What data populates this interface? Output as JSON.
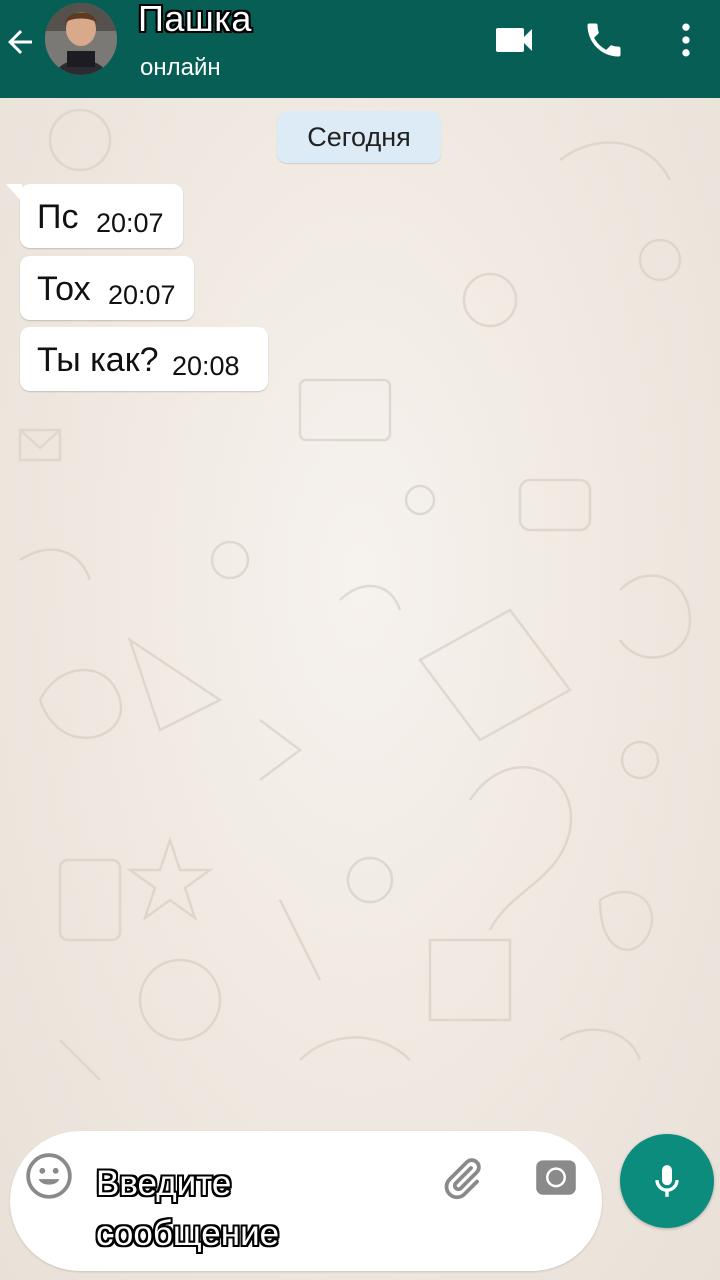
{
  "header": {
    "contact_name": "Пашка",
    "status": "онлайн",
    "icons": [
      "back-arrow-icon",
      "video-call-icon",
      "phone-icon",
      "more-vert-icon"
    ]
  },
  "date_chip": "Сегодня",
  "messages": [
    {
      "text": "Пс",
      "time": "20:07"
    },
    {
      "text": "Тох",
      "time": "20:07"
    },
    {
      "text": "Ты как?",
      "time": "20:08"
    }
  ],
  "composer": {
    "placeholder": "Введите сообщение",
    "icons": [
      "emoji-icon",
      "paperclip-icon",
      "camera-icon",
      "mic-icon"
    ]
  },
  "colors": {
    "header_bg": "#075e54",
    "mic_button": "#0c8c7d",
    "date_chip_bg": "#dcebf5",
    "chat_bg": "#ece5dd"
  }
}
